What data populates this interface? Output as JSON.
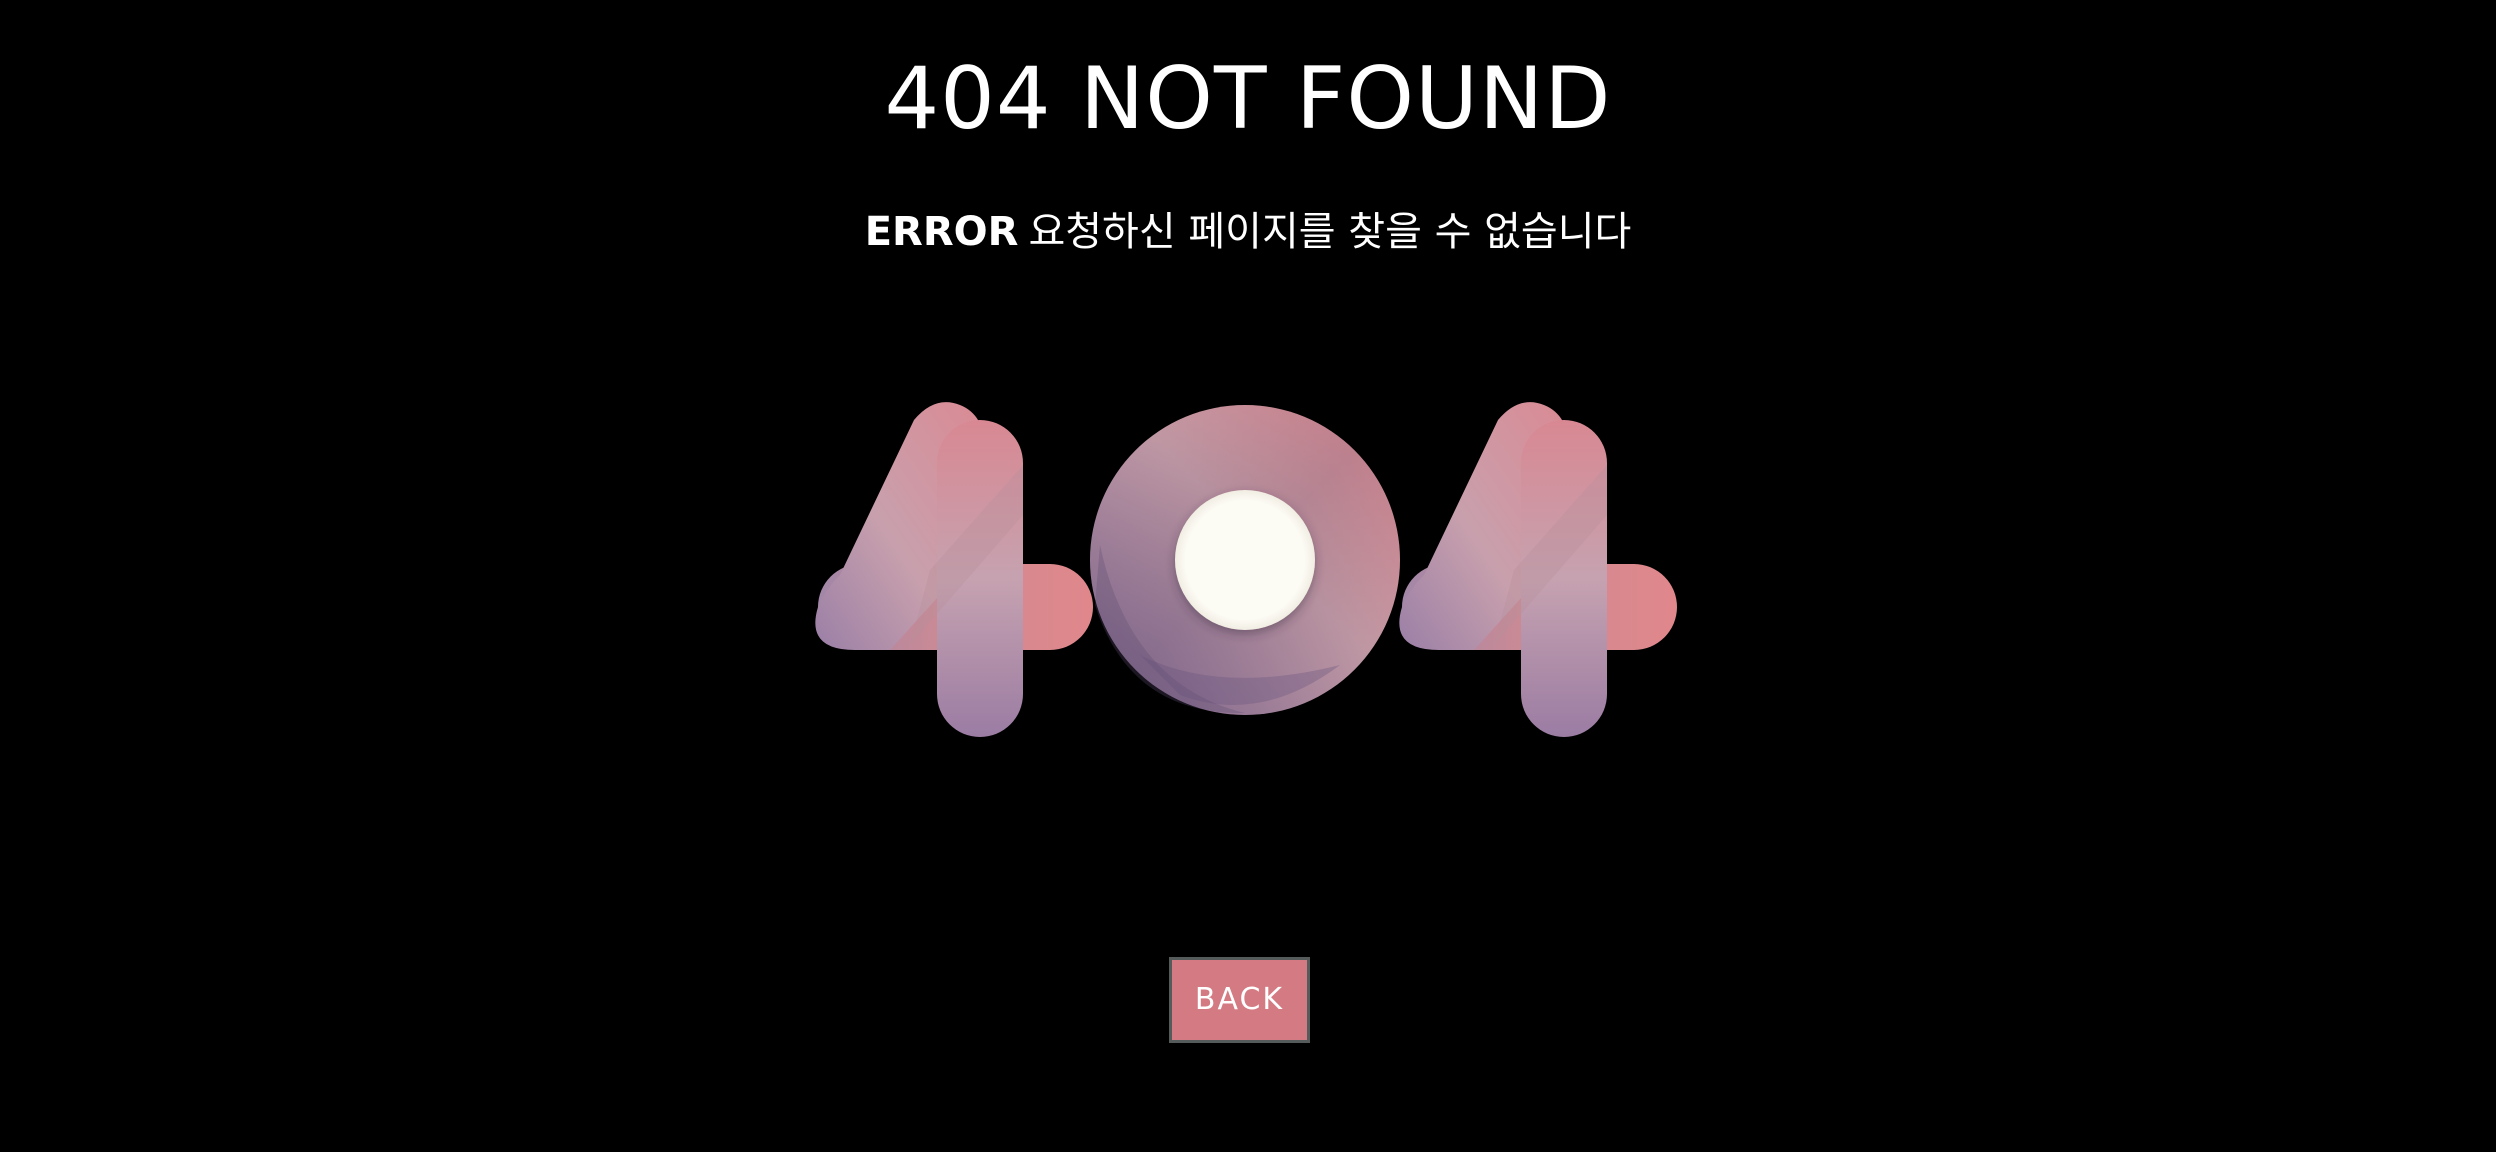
{
  "header": {
    "title": "404 NOT FOUND"
  },
  "message": {
    "label": "ERROR",
    "text": "요청하신 페이지를 찾을 수 없습니다"
  },
  "illustration": {
    "icon": "404-graphic-icon",
    "colors": {
      "pink": "#e08a8f",
      "mauve": "#c9a0ae",
      "purple": "#9a7ea4",
      "center": "#fbf9f2"
    }
  },
  "actions": {
    "back_label": "BACK",
    "back_color": "#d37a82"
  }
}
